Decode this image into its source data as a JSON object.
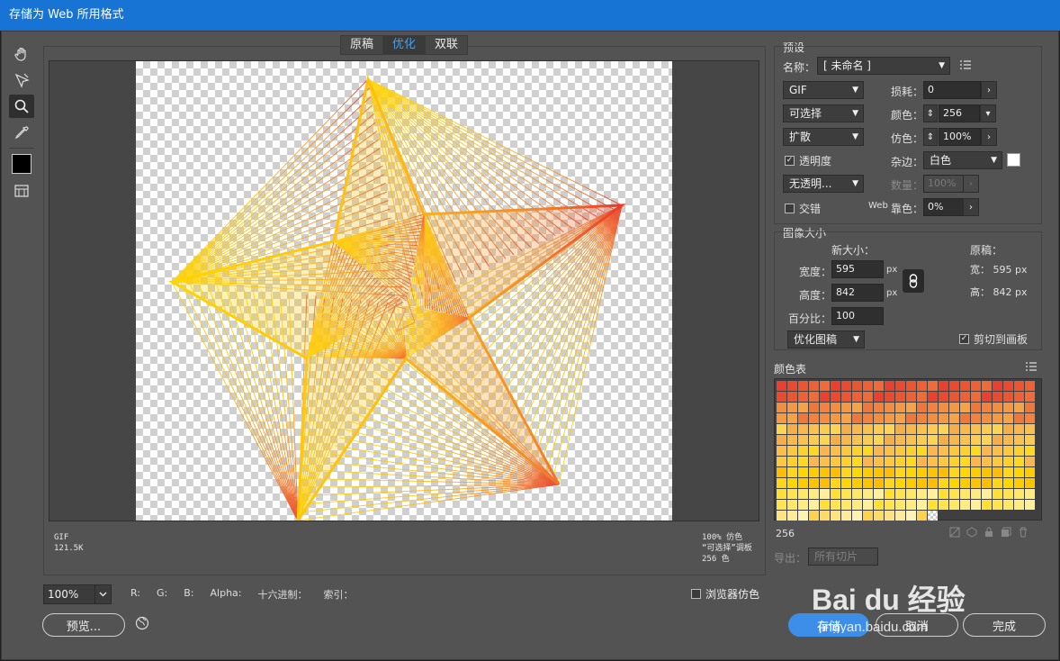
{
  "window": {
    "title": "存储为 Web 所用格式"
  },
  "tabs": [
    {
      "label": "原稿",
      "active": false
    },
    {
      "label": "优化",
      "active": true
    },
    {
      "label": "双联",
      "active": false
    }
  ],
  "tools": [
    "hand-tool-icon",
    "slice-select-tool-icon",
    "zoom-tool-icon",
    "eyedropper-tool-icon",
    "eyedropper-color-swatch",
    "toggle-slice-visibility-icon"
  ],
  "preview_info": {
    "format": "GIF",
    "size": "121.5K",
    "dither": "100% 仿色",
    "palette": "“可选择”调板",
    "colors": "256 色"
  },
  "bottom": {
    "zoom": "100%",
    "r": "R:",
    "g": "G:",
    "b": "B:",
    "alpha": "Alpha:",
    "hex": "十六进制：",
    "index": "索引：",
    "browser_dither": "浏览器仿色",
    "preview_btn": "预览...",
    "save_btn": "存储",
    "cancel_btn": "取消",
    "done_btn": "完成"
  },
  "preset": {
    "section": "预设",
    "name_label": "名称：",
    "name_value": "[ 未命名 ]",
    "format": "GIF",
    "lossy_label": "损耗：",
    "lossy_value": "0",
    "reduction": "可选择",
    "colors_label": "颜色：",
    "colors_value": "256",
    "dither_algo": "扩散",
    "dither_label": "仿色：",
    "dither_value": "100%",
    "transparency_label": "透明度",
    "transparency_checked": true,
    "matte_label": "杂边：",
    "matte_value": "白色",
    "matte_color": "#ffffff",
    "trans_dither": "无透明...",
    "amount_label": "数量：",
    "amount_value": "100%",
    "interlaced_label": "交错",
    "interlaced_checked": false,
    "web_snap_prefix": "Web",
    "web_snap_label": "靠色：",
    "web_snap_value": "0%"
  },
  "image_size": {
    "section": "图像大小",
    "new_size_label": "新大小：",
    "width_label": "宽度：",
    "width_value": "595",
    "height_label": "高度：",
    "height_value": "842",
    "unit": "px",
    "percent_label": "百分比：",
    "percent_value": "100",
    "original_label": "原稿：",
    "orig_width": "宽： 595 px",
    "orig_height": "高： 842 px",
    "quality": "优化图稿",
    "clip_label": "剪切到画板",
    "clip_checked": true
  },
  "color_table": {
    "section": "颜色表",
    "count": "256",
    "export_label": "导出：",
    "export_value": "所有切片"
  },
  "watermark": {
    "text": "Bai du 经验",
    "url": "jingyan.baidu.com"
  },
  "colors": {
    "titlebar": "#1774d4",
    "panel": "#535353",
    "accent": "#3d8ee8",
    "tab_active": "#4a9ff0"
  }
}
